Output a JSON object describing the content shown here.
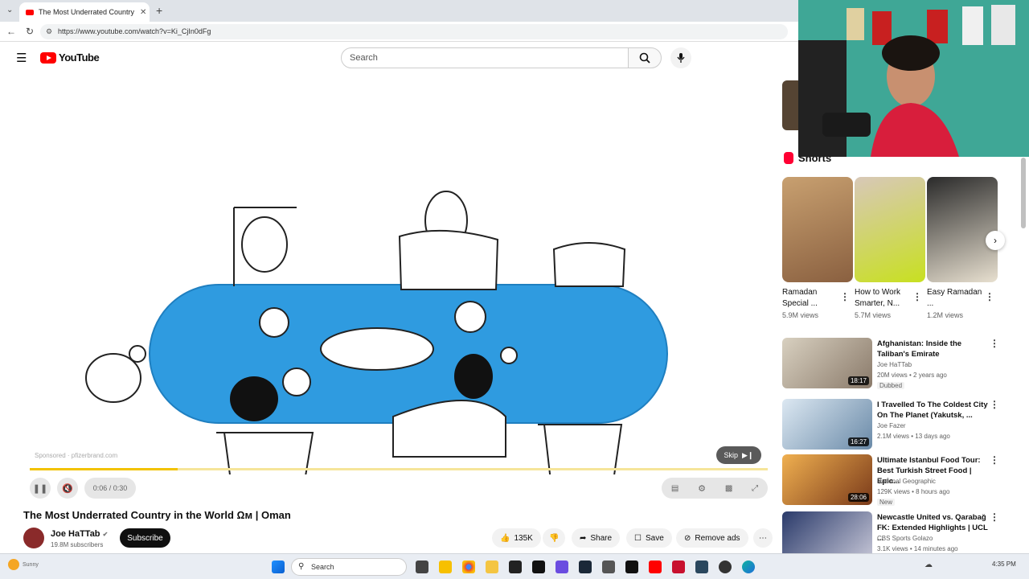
{
  "browser": {
    "tab_title": "The Most Underrated Country in th",
    "url": "https://www.youtube.com/watch?v=Ki_CjIn0dFg"
  },
  "youtube": {
    "logo_text": "YouTube",
    "search_placeholder": "Search"
  },
  "player": {
    "sponsor_text": "Sponsored · pfizerbrand.com",
    "time": "0:06 / 0:30",
    "skip_label": "Skip",
    "progress_fraction": 0.2
  },
  "video": {
    "title": "The Most Underrated Country in the World Ωᴍ | Oman",
    "channel": "Joe HaTTab",
    "subscribers": "19.8M subscribers",
    "subscribe_label": "Subscribe",
    "likes": "135K",
    "share_label": "Share",
    "save_label": "Save",
    "remove_ads_label": "Remove ads"
  },
  "shorts": {
    "heading": "Shorts",
    "items": [
      {
        "title": "Ramadan Special ...",
        "views": "5.9M views"
      },
      {
        "title": "How to Work Smarter, N...",
        "views": "5.7M views"
      },
      {
        "title": "Easy Ramadan ...",
        "views": "1.2M views"
      }
    ]
  },
  "recommendations": [
    {
      "title": "Afghanistan: Inside the Taliban's Emirate",
      "channel": "Joe HaTTab",
      "meta": "20M views • 2 years ago",
      "badge": "Dubbed",
      "duration": "18:17"
    },
    {
      "title": "I Travelled To The Coldest City On The Planet (Yakutsk, ...",
      "channel": "Joe Fazer",
      "meta": "2.1M views • 13 days ago",
      "badge": "",
      "duration": "16:27"
    },
    {
      "title": "Ultimate Istanbul Food Tour: Best Turkish Street Food | Epic...",
      "channel": "National Geographic",
      "meta": "129K views • 8 hours ago",
      "badge": "New",
      "duration": "28:06"
    },
    {
      "title": "Newcastle United vs. Qarabağ FK: Extended Highlights | UCL ...",
      "channel": "CBS Sports Golazo",
      "meta": "3.1K views • 14 minutes ago",
      "badge": "",
      "duration": ""
    }
  ],
  "taskbar": {
    "search_label": "Search",
    "clock": "4:35 PM",
    "weather_line1": "Sunny"
  },
  "colors": {
    "yt_red": "#ff0000",
    "table_blue": "#2f9be0",
    "progress_yellow": "#f2c200"
  }
}
